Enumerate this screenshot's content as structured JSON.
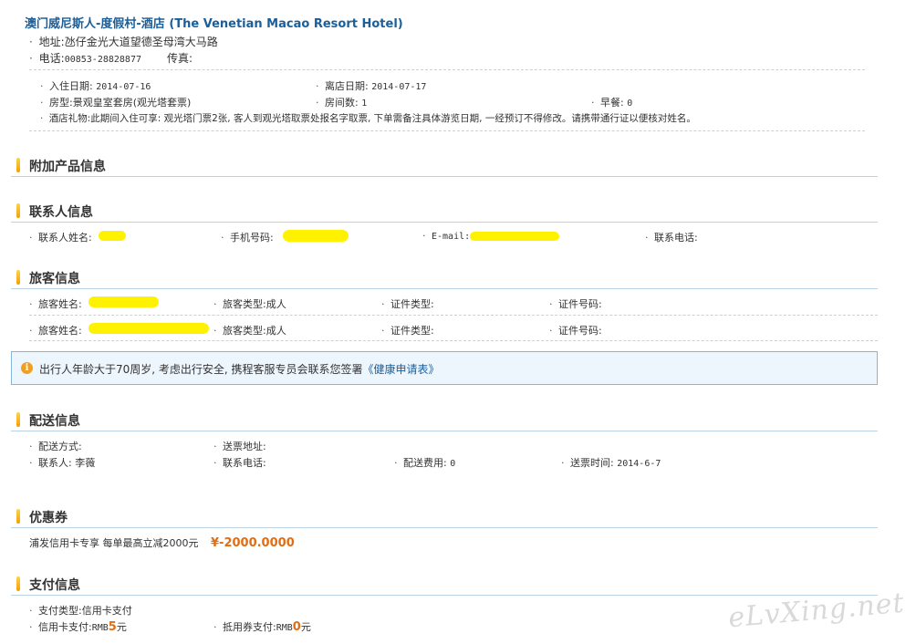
{
  "hotel": {
    "name": "澳门威尼斯人-度假村-酒店 (The Venetian Macao Resort Hotel)",
    "address_label": "地址:",
    "address": "氹仔金光大道望德圣母湾大马路",
    "phone_label": "电话:",
    "phone": "00853-28828877",
    "fax_label": "传真:",
    "fax": ""
  },
  "booking": {
    "checkin_label": "入住日期:",
    "checkin": "2014-07-16",
    "checkout_label": "离店日期:",
    "checkout": "2014-07-17",
    "room_type_label": "房型:",
    "room_type": "景观皇室套房(观光塔套票)",
    "rooms_label": "房间数:",
    "rooms": "1",
    "breakfast_label": "早餐:",
    "breakfast": "0",
    "gift_label": "酒店礼物:",
    "gift": "此期间入住可享: 观光塔门票2张, 客人到观光塔取票处报名字取票, 下单需备注具体游览日期, 一经预订不得修改。请携带通行证以便核对姓名。"
  },
  "sections": {
    "addon": "附加产品信息",
    "contact": "联系人信息",
    "traveler": "旅客信息",
    "delivery": "配送信息",
    "coupon": "优惠券",
    "payment": "支付信息"
  },
  "contact": {
    "name_label": "联系人姓名:",
    "mobile_label": "手机号码:",
    "email_label": "E-mail:",
    "tel_label": "联系电话:"
  },
  "travelers": [
    {
      "name_label": "旅客姓名:",
      "type_label": "旅客类型:",
      "type": "成人",
      "id_type_label": "证件类型:",
      "id_no_label": "证件号码:"
    },
    {
      "name_label": "旅客姓名:",
      "type_label": "旅客类型:",
      "type": "成人",
      "id_type_label": "证件类型:",
      "id_no_label": "证件号码:"
    }
  ],
  "notice": {
    "text": "出行人年龄大于70周岁, 考虑出行安全, 携程客服专员会联系您签署",
    "link": "《健康申请表》"
  },
  "delivery": {
    "method_label": "配送方式:",
    "address_label": "送票地址:",
    "contact_label": "联系人:",
    "contact": "李薇",
    "tel_label": "联系电话:",
    "fee_label": "配送费用:",
    "fee": "0",
    "time_label": "送票时间:",
    "time": "2014-6-7"
  },
  "coupon": {
    "desc": "浦发信用卡专享 每单最高立减2000元",
    "amount": "¥-2000.0000"
  },
  "payment": {
    "type_label": "支付类型:",
    "type": "信用卡支付",
    "card_label": "信用卡支付:",
    "card_currency": "RMB",
    "card_amount": "5",
    "card_unit": "元",
    "voucher_label": "抵用券支付:",
    "voucher_currency": "RMB",
    "voucher_amount": "0",
    "voucher_unit": "元"
  },
  "watermark": "eLvXing.net",
  "colors": {
    "title": "#1a5e9a",
    "accent": "#e26d13",
    "highlight": "#fff200"
  }
}
